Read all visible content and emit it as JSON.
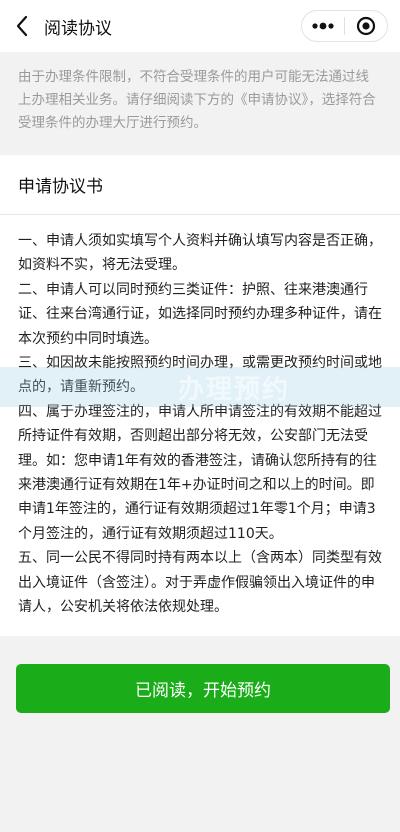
{
  "nav": {
    "title": "阅读协议",
    "back_icon": "chevron-left-icon",
    "more_icon": "more-dots-icon",
    "close_icon": "record-circle-icon"
  },
  "notice": "由于办理条件限制，不符合受理条件的用户可能无法通过线上办理相关业务。请仔细阅读下方的《申请协议》，选择符合受理条件的办理大厅进行预约。",
  "agreement": {
    "title": "申请协议书",
    "items": [
      "一、申请人须如实填写个人资料并确认填写内容是否正确，如资料不实，将无法受理。",
      "二、申请人可以同时预约三类证件：护照、往来港澳通行证、往来台湾通行证，如选择同时预约办理多种证件，请在本次预约中同时填选。",
      "三、如因故未能按照预约时间办理，或需更改预约时间或地点的，请重新预约。",
      "四、属于办理签注的，申请人所申请签注的有效期不能超过所持证件有效期，否则超出部分将无效，公安部门无法受理。如：您申请1年有效的香港签注，请确认您所持有的往来港澳通行证有效期在1年+办证时间之和以上的时间。即申请1年签注的，通行证有效期须超过1年零1个月；申请3个月签注的，通行证有效期须超过110天。",
      "五、同一公民不得同时持有两本以上（含两本）同类型有效出入境证件（含签注）。对于弄虚作假骗领出入境证件的申请人，公安机关将依法依规处理。"
    ]
  },
  "watermark": "办理预约",
  "button": {
    "label": "已阅读，开始预约"
  },
  "colors": {
    "accent": "#1aad19",
    "background": "#f2f2f2"
  }
}
